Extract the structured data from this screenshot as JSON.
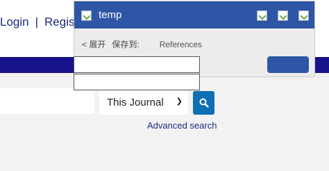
{
  "site": {
    "login_label": "Login",
    "separator": "|",
    "register_label": "Regist"
  },
  "search": {
    "input_value": "",
    "scope_selected": "This Journal",
    "search_icon": "magnifier-icon",
    "advanced_label": "Advanced search"
  },
  "popup": {
    "title": "temp",
    "expand_label": "< 展开",
    "save_to_label": "保存到:",
    "collection_label": "References",
    "field_1_value": "",
    "field_2_value": "",
    "header_icons": [
      "broken-image-icon",
      "broken-image-icon",
      "broken-image-icon",
      "broken-image-icon"
    ]
  },
  "colors": {
    "nav_bar": "#17138a",
    "popup_header": "#2f56a6",
    "search_button": "#0d6fb3",
    "link": "#1b2a7a"
  }
}
